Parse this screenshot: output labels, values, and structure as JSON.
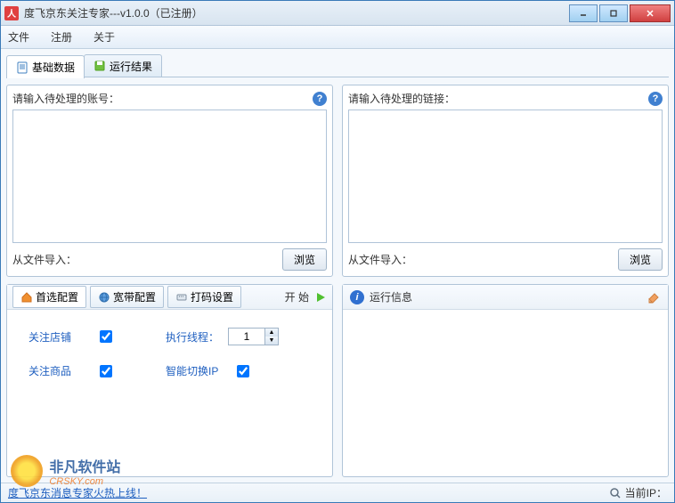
{
  "window": {
    "title": "度飞京东关注专家---v1.0.0（已注册）"
  },
  "menu": {
    "file": "文件",
    "register": "注册",
    "about": "关于"
  },
  "top_tabs": {
    "basic_data": "基础数据",
    "run_result": "运行结果"
  },
  "left_input": {
    "label": "请输入待处理的账号：",
    "import_label": "从文件导入：",
    "browse": "浏览"
  },
  "right_input": {
    "label": "请输入待处理的链接：",
    "import_label": "从文件导入：",
    "browse": "浏览"
  },
  "config_tabs": {
    "pref": "首选配置",
    "broadband": "宽带配置",
    "captcha": "打码设置",
    "start": "开 始"
  },
  "config": {
    "follow_shop": "关注店铺",
    "follow_shop_checked": true,
    "follow_goods": "关注商品",
    "follow_goods_checked": true,
    "threads_label": "执行线程：",
    "threads_value": "1",
    "smart_ip_label": "智能切换IP",
    "smart_ip_checked": true
  },
  "runtime": {
    "title": "运行信息"
  },
  "status": {
    "link_text": "度飞京东消息专家火热上线！",
    "ip_label": "当前IP："
  },
  "watermark": {
    "line1": "非凡软件站",
    "line2": "CRSKY.com"
  }
}
